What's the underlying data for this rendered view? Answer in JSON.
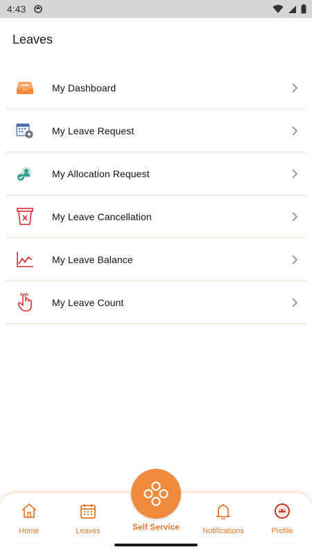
{
  "status_bar": {
    "time": "4:43"
  },
  "page": {
    "title": "Leaves"
  },
  "menu": {
    "items": [
      {
        "label": "My Dashboard",
        "icon": "inbox-tray-icon"
      },
      {
        "label": "My Leave Request",
        "icon": "calendar-add-icon"
      },
      {
        "label": "My Allocation Request",
        "icon": "user-check-icon"
      },
      {
        "label": "My Leave Cancellation",
        "icon": "cancel-bin-icon"
      },
      {
        "label": "My Leave Balance",
        "icon": "line-chart-icon"
      },
      {
        "label": "My Leave Count",
        "icon": "tap-hand-icon"
      }
    ]
  },
  "bottom_nav": {
    "home": "Home",
    "leaves": "Leaves",
    "self_service": "Self Service",
    "notifications": "Notifications",
    "profile": "Profile"
  },
  "colors": {
    "accent": "#ef8a3c",
    "nav_label": "#e8762b",
    "divider": "#f6dcc6",
    "status_bar": "#d6d6d6"
  }
}
